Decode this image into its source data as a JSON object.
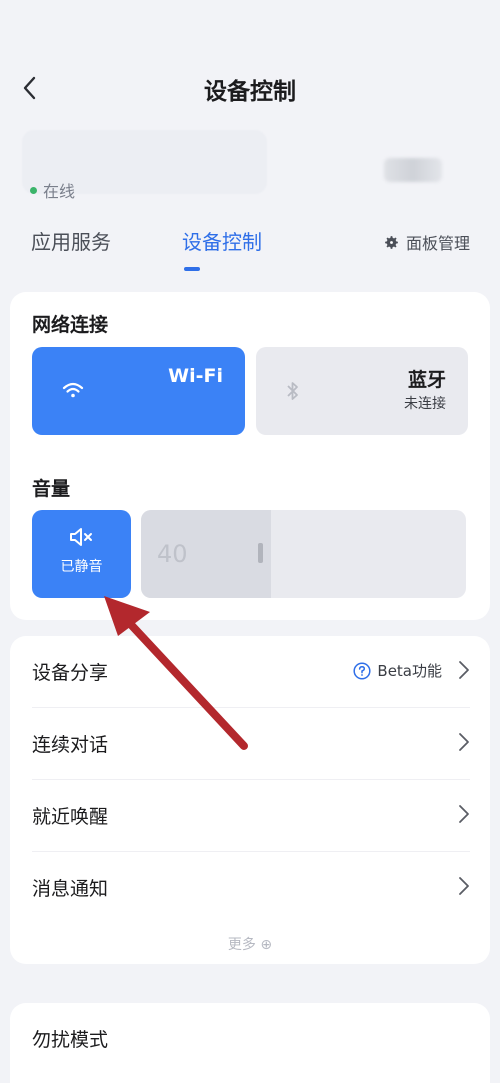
{
  "header": {
    "title": "设备控制",
    "back_icon": "chevron-left-icon"
  },
  "device": {
    "status": "在线",
    "status_color": "#3bb46a"
  },
  "tabs": [
    {
      "label": "应用服务"
    },
    {
      "label": "设备控制",
      "active": true
    }
  ],
  "panel_mgmt": {
    "label": "面板管理",
    "icon": "gear-icon"
  },
  "network": {
    "title": "网络连接",
    "wifi": {
      "name": "Wi-Fi",
      "sub": "",
      "active": true,
      "color": "#3b82f6"
    },
    "bluetooth": {
      "name": "蓝牙",
      "sub": "未连接",
      "active": false
    }
  },
  "volume": {
    "title": "音量",
    "mute_label": "已静音",
    "value": "40",
    "level": 0.4
  },
  "settings": [
    {
      "label": "设备分享",
      "badge": "Beta功能"
    },
    {
      "label": "连续对话"
    },
    {
      "label": "就近唤醒"
    },
    {
      "label": "消息通知"
    }
  ],
  "more_label": "更多",
  "dnd": {
    "label": "勿扰模式"
  },
  "annotation": {
    "color": "#b3282d"
  }
}
